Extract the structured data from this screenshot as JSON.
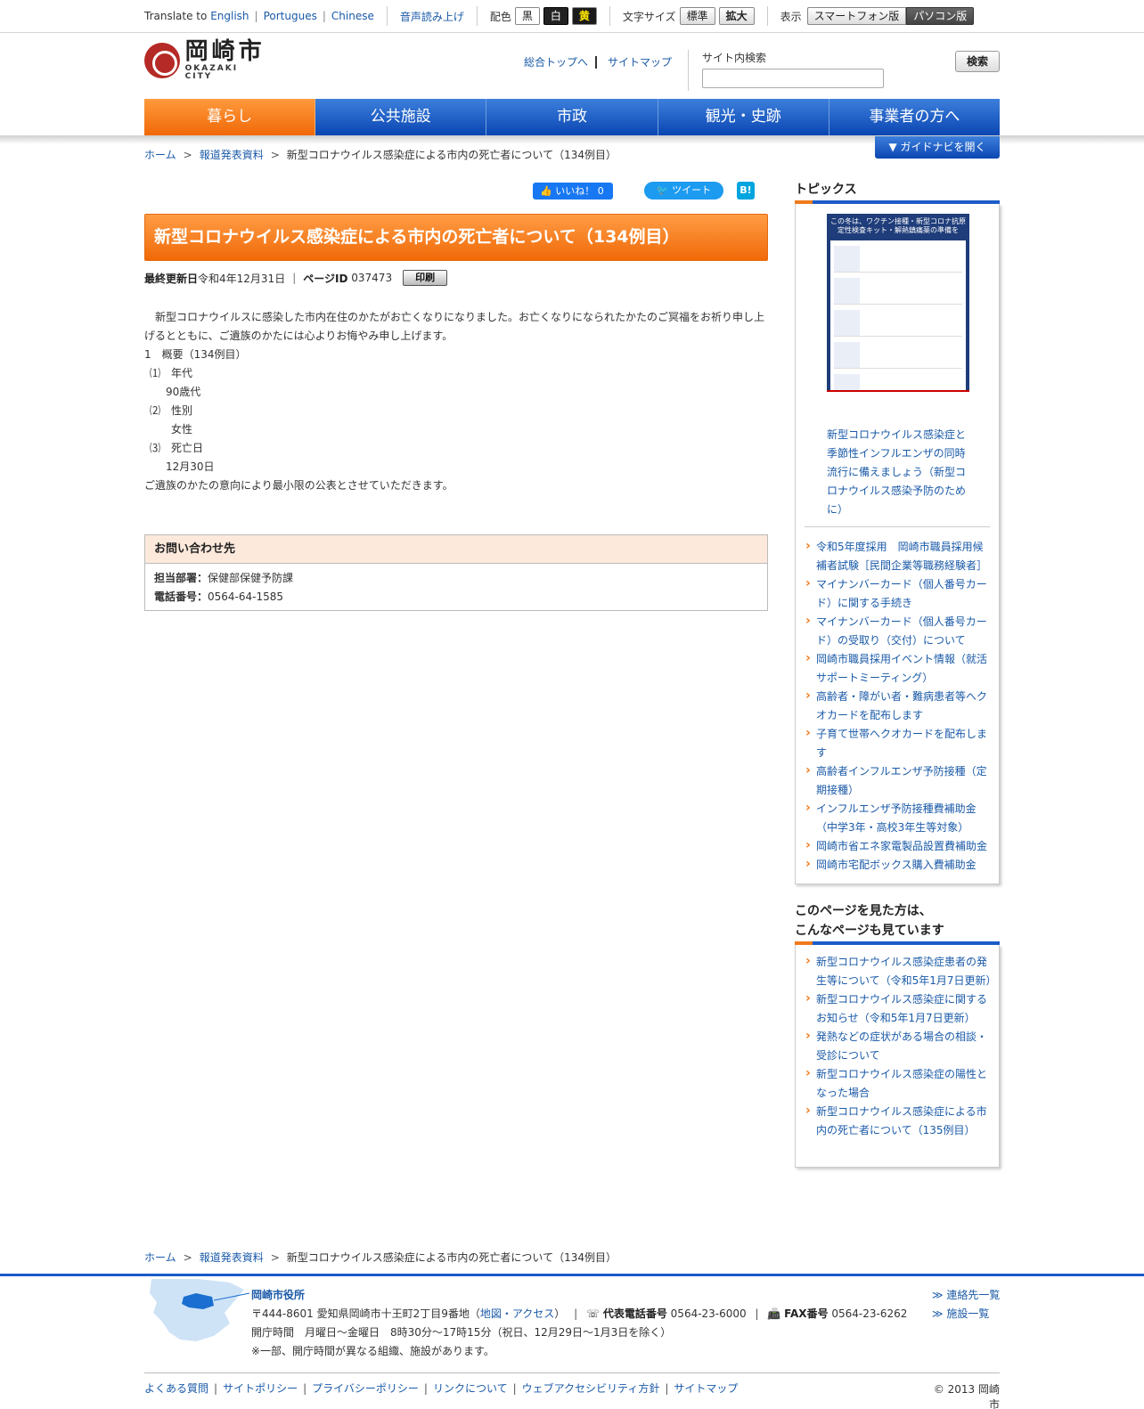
{
  "topbar": {
    "translate_label": "Translate to",
    "languages": [
      "English",
      "Portugues",
      "Chinese"
    ],
    "voice": "音声読み上げ",
    "color_label": "配色",
    "colors": [
      "黒",
      "白",
      "黄"
    ],
    "font_label": "文字サイズ",
    "font_sizes": [
      "標準",
      "拡大"
    ],
    "display_label": "表示",
    "display_modes": [
      "スマートフォン版",
      "パソコン版"
    ]
  },
  "header": {
    "logo_jp": "岡崎市",
    "logo_en": "OKAZAKI CITY",
    "top_link": "総合トップへ",
    "sitemap_link": "サイトマップ",
    "search_label": "サイト内検索",
    "search_value": "",
    "search_button": "検索"
  },
  "gnav": [
    "暮らし",
    "公共施設",
    "市政",
    "観光・史跡",
    "事業者の方へ"
  ],
  "guide_button": "▼ ガイドナビを開く",
  "breadcrumb": {
    "home": "ホーム",
    "parent": "報道発表資料",
    "current": "新型コロナウイルス感染症による市内の死亡者について（134例目）"
  },
  "social": {
    "like": "いいね！ 0",
    "tweet": "ツイート",
    "hatena": "B!"
  },
  "article": {
    "title": "新型コロナウイルス感染症による市内の死亡者について（134例目）",
    "updated_label": "最終更新日",
    "updated_value": "令和4年12月31日",
    "page_id_label": "ページID",
    "page_id_value": "037473",
    "print_button": "印刷",
    "intro": "　新型コロナウイルスに感染した市内在住のかたがお亡くなりになりました。お亡くなりになられたかたのご冥福をお祈り申し上げるとともに、ご遺族のかたには心よりお悔やみ申し上げます。",
    "outline": "1　概要（134例目）",
    "age_label": "⑴　年代",
    "age_value": "90歳代",
    "sex_label": "⑵　性別",
    "sex_value": "女性",
    "date_label": "⑶　死亡日",
    "date_value": "12月30日",
    "closing": "ご遺族のかたの意向により最小限の公表とさせていただきます。"
  },
  "contact": {
    "heading": "お問い合わせ先",
    "dept_label": "担当部署：",
    "dept_value": "保健部保健予防課",
    "tel_label": "電話番号：",
    "tel_value": "0564-64-1585"
  },
  "sidebar": {
    "topics_title": "トピックス",
    "poster_caption": "新型コロナウイルス感染症と季節性インフルエンザの同時流行に備えましょう（新型コロナウイルス感染予防のために）",
    "poster_header": "この冬は、ワクチン接種・新型コロナ抗原定性検査キット・解熱鎮痛薬の準備を",
    "topics": [
      "令和5年度採用　岡崎市職員採用候補者試験［民間企業等職務経験者］",
      "マイナンバーカード（個人番号カード）に関する手続き",
      "マイナンバーカード（個人番号カード）の受取り（交付）について",
      "岡崎市職員採用イベント情報（就活サポートミーティング）",
      "高齢者・障がい者・難病患者等へクオカードを配布します",
      "子育て世帯へクオカードを配布します",
      "高齢者インフルエンザ予防接種（定期接種）",
      "インフルエンザ予防接種費補助金（中学3年・高校3年生等対象）",
      "岡崎市省エネ家電製品設置費補助金",
      "岡崎市宅配ボックス購入費補助金"
    ],
    "related_title_1": "このページを見た方は、",
    "related_title_2": "こんなページも見ています",
    "related": [
      "新型コロナウイルス感染症患者の発生等について（令和5年1月7日更新）",
      "新型コロナウイルス感染症に関するお知らせ（令和5年1月7日更新）",
      "発熱などの症状がある場合の相談・受診について",
      "新型コロナウイルス感染症の陽性となった場合",
      "新型コロナウイルス感染症による市内の死亡者について（135例目）"
    ]
  },
  "footer": {
    "office": "岡崎市役所",
    "address": "〒444-8601 愛知県岡崎市十王町2丁目9番地",
    "map_link": "地図・アクセス",
    "tel_label": "代表電話番号",
    "tel_value": "0564-23-6000",
    "fax_label": "FAX番号",
    "fax_value": "0564-23-6262",
    "hours": "開庁時間　月曜日～金曜日　8時30分～17時15分（祝日、12月29日～1月3日を除く）",
    "note": "※一部、開庁時間が異なる組織、施設があります。",
    "contact_list": "≫ 連絡先一覧",
    "facility_list": "≫ 施設一覧",
    "links": [
      "よくある質問",
      "サイトポリシー",
      "プライバシーポリシー",
      "リンクについて",
      "ウェブアクセシビリティ方針",
      "サイトマップ"
    ],
    "copyright": "© 2013 岡崎市"
  }
}
